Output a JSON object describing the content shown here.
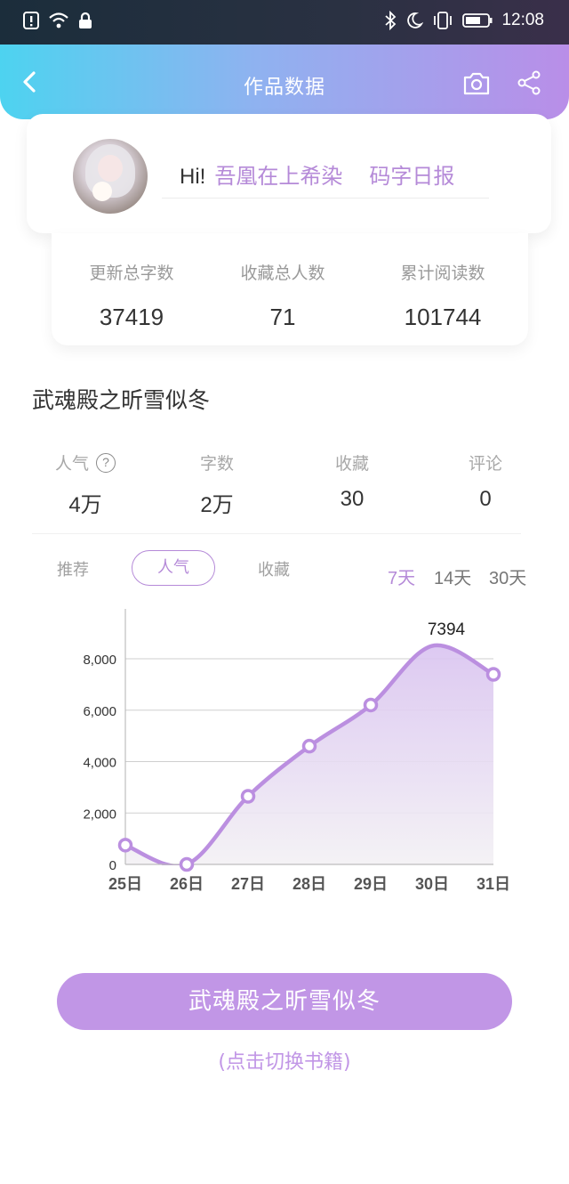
{
  "status_bar": {
    "time": "12:08"
  },
  "header": {
    "title": "作品数据",
    "icons": [
      "back-chevron-icon",
      "camera-icon",
      "share-icon"
    ]
  },
  "profile": {
    "greeting": "Hi!",
    "username": "吾凰在上希染",
    "daily_report": "码字日报"
  },
  "summary": [
    {
      "label": "更新总字数",
      "value": "37419"
    },
    {
      "label": "收藏总人数",
      "value": "71"
    },
    {
      "label": "累计阅读数",
      "value": "101744"
    }
  ],
  "book": {
    "title": "武魂殿之昕雪似冬"
  },
  "metrics": [
    {
      "label": "人气",
      "value": "4万"
    },
    {
      "label": "字数",
      "value": "2万"
    },
    {
      "label": "收藏",
      "value": "30"
    },
    {
      "label": "评论",
      "value": "0"
    }
  ],
  "chart_tabs": [
    "推荐",
    "人气",
    "收藏"
  ],
  "active_chart_tab": "人气",
  "ranges": [
    "7天",
    "14天",
    "30天"
  ],
  "active_range": "7天",
  "colors": {
    "accent": "#b58ad8",
    "button": "#c196e6",
    "line": "#bb8fe0"
  },
  "chart_data": {
    "type": "area",
    "x": [
      "25日",
      "26日",
      "27日",
      "28日",
      "29日",
      "30日",
      "31日"
    ],
    "series": [
      {
        "values": [
          750,
          0,
          2650,
          4600,
          6200,
          8500,
          7394
        ]
      }
    ],
    "ylim": [
      0,
      8000
    ],
    "yticks": [
      "0",
      "2,000",
      "4,000",
      "6,000",
      "8,000"
    ],
    "annotation": "7394",
    "grid": true
  },
  "footer": {
    "switch_button": "武魂殿之昕雪似冬",
    "switch_hint": "(点击切换书籍)"
  }
}
